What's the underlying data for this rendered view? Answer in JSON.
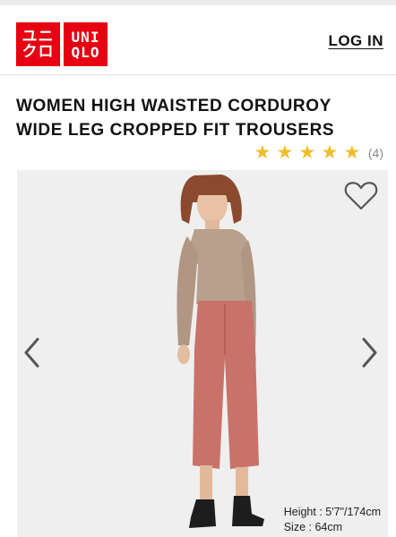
{
  "header": {
    "logo": {
      "line1_jp": "ユニ",
      "line2_jp": "クロ",
      "line1_en": "UNI",
      "line2_en": "QLO"
    },
    "login_label": "LOG IN"
  },
  "product": {
    "title": "WOMEN HIGH WAISTED CORDUROY WIDE LEG CROPPED FIT TROUSERS",
    "rating": {
      "stars": 5,
      "max_stars": 5,
      "count_label": "(4)"
    }
  },
  "gallery": {
    "model_height": "Height : 5'7\"/174cm",
    "model_size": "Size : 64cm",
    "icons": {
      "favorite": "heart-outline-icon",
      "prev": "chevron-left-icon",
      "next": "chevron-right-icon"
    }
  },
  "colors": {
    "brand_red": "#e60012",
    "star": "#f0be29",
    "trousers": "#c8726a",
    "sweater": "#b9a08c"
  }
}
